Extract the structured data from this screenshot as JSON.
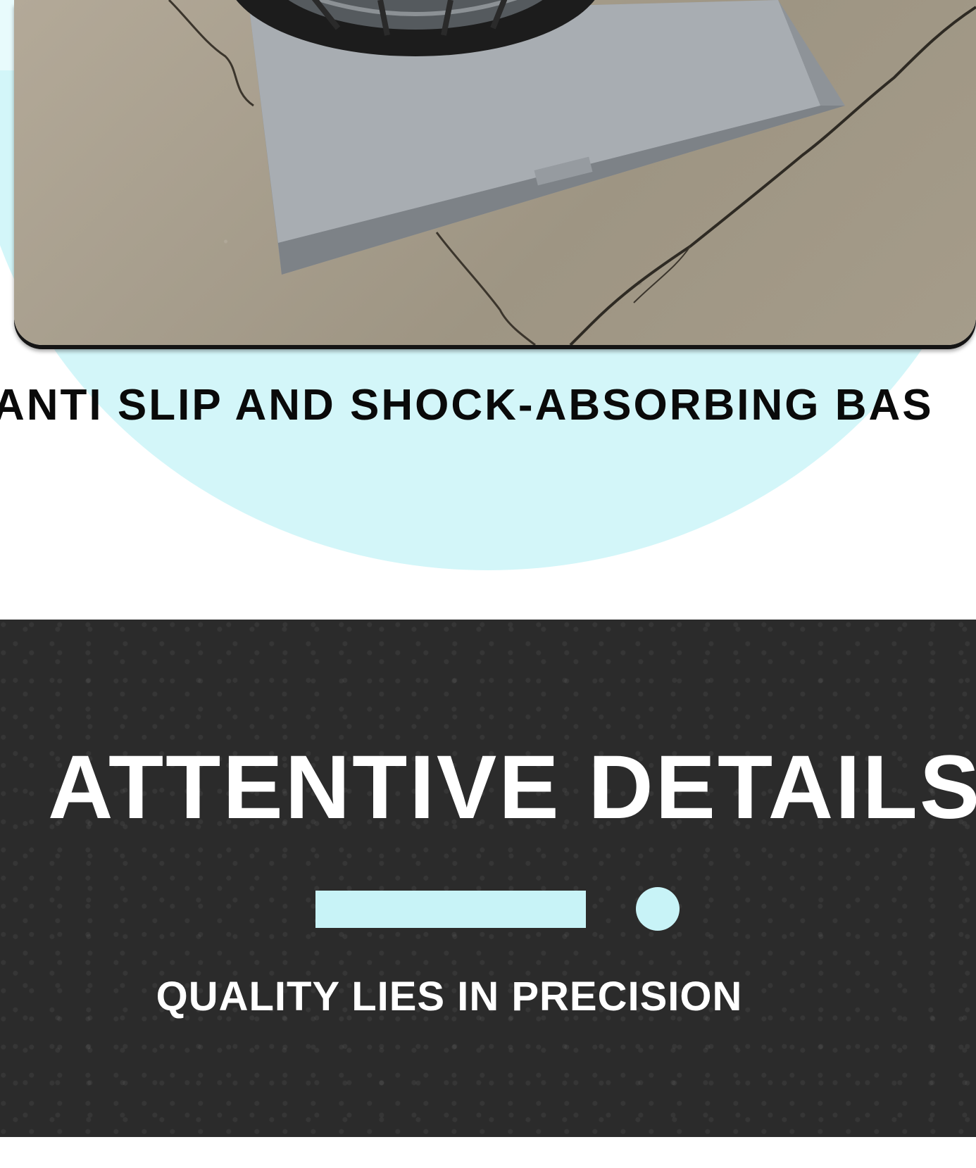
{
  "feature_caption": "ANTI SLIP AND SHOCK-ABSORBING BAS",
  "details": {
    "title": "ATTENTIVE DETAILS",
    "subtitle": "QUALITY LIES IN PRECISION"
  },
  "colors": {
    "accent": "#c8f3f7",
    "dark_background": "#2b2b2b",
    "bowl_background": "#d3f6f9"
  }
}
